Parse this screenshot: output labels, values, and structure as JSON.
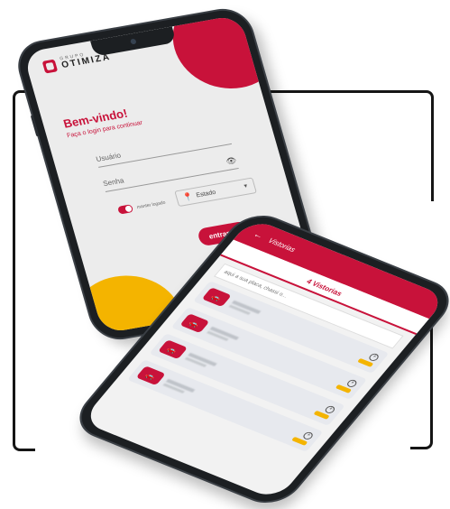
{
  "login": {
    "brand_small": "GRUPO",
    "brand_name": "OTIMIZA",
    "title": "Bem-vindo!",
    "subtitle": "Faça o login para continuar",
    "user_placeholder": "Usuário",
    "password_placeholder": "Senha",
    "keep_logged": "manter logado",
    "state_select": "Estado",
    "submit": "entrar"
  },
  "vistorias": {
    "appbar_title": "Vistorias",
    "tab_label": "4 Vistorias",
    "search_placeholder": "aqui a sua placa, chassi o...",
    "items": [
      "",
      "",
      "",
      ""
    ]
  },
  "colors": {
    "brand": "#c8123a",
    "accent": "#f4b400"
  },
  "icons": [
    "eye-icon",
    "pin-icon",
    "caret-down-icon",
    "enter-icon",
    "back-arrow-icon",
    "car-icon",
    "plus-icon"
  ]
}
